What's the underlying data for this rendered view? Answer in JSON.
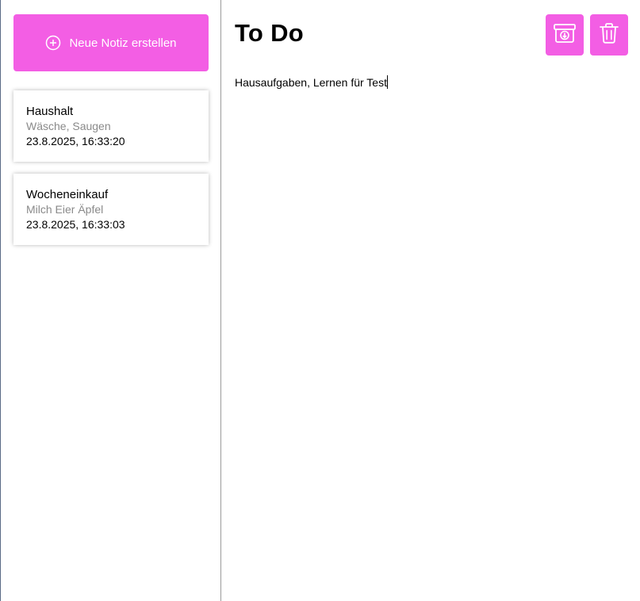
{
  "sidebar": {
    "new_note_label": "Neue Notiz erstellen",
    "notes": [
      {
        "title": "Haushalt",
        "preview": "Wäsche, Saugen",
        "date": "23.8.2025, 16:33:20"
      },
      {
        "title": "Wocheneinkauf",
        "preview": "Milch Eier Äpfel",
        "date": "23.8.2025, 16:33:03"
      }
    ]
  },
  "editor": {
    "title": "To Do",
    "body": "Hausaufgaben, Lernen für Test"
  },
  "icons": {
    "new_note": "plus-circle-icon",
    "archive": "archive-icon",
    "delete": "trash-icon"
  },
  "colors": {
    "accent": "#f35ee4",
    "preview_text": "#8a8a8a"
  }
}
